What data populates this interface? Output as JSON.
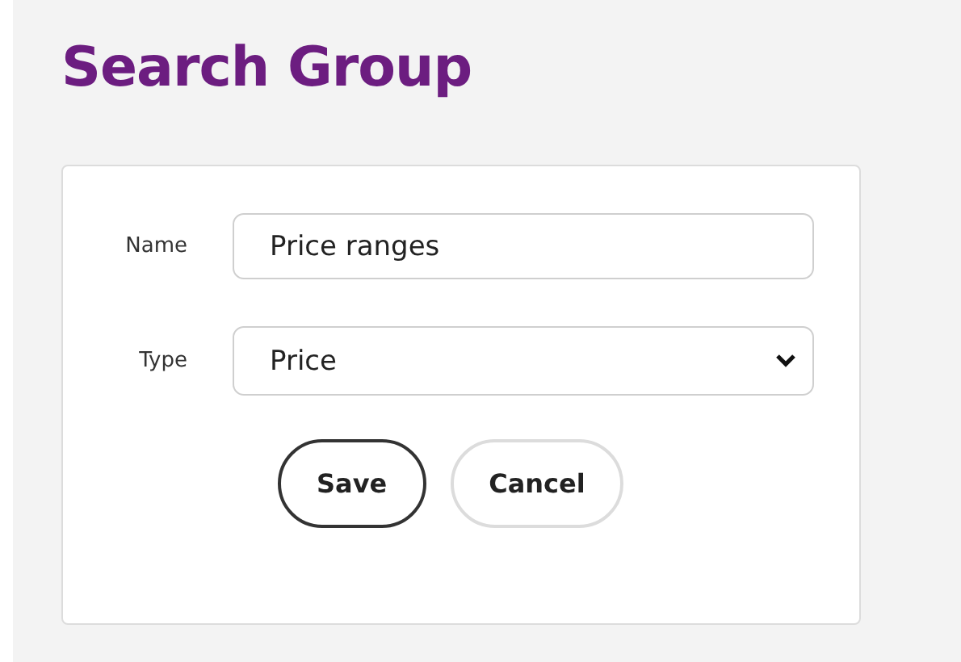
{
  "title": "Search Group",
  "fields": [
    {
      "kind": "text",
      "label": "Name",
      "value": "Price ranges"
    },
    {
      "kind": "select",
      "label": "Type",
      "value": "Price"
    }
  ],
  "buttons": [
    {
      "label": "Save",
      "primary": true
    },
    {
      "label": "Cancel",
      "primary": false
    }
  ]
}
